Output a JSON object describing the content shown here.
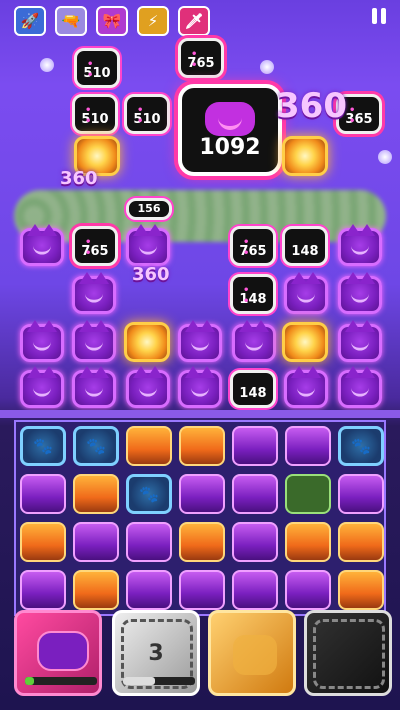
{
  "top_bar": {
    "powers": [
      {
        "name": "rocket-power",
        "color": "#3b6bd6",
        "glyph": "🚀"
      },
      {
        "name": "gun-power",
        "color": "#9a8ae0",
        "glyph": "🔫"
      },
      {
        "name": "bow-power",
        "color": "#b03ad0",
        "glyph": "🎀"
      },
      {
        "name": "battery-power",
        "color": "#e0a020",
        "glyph": "⚡"
      },
      {
        "name": "sword-power",
        "color": "#e0307a",
        "glyph": "🗡"
      }
    ],
    "pause_icon": "pause-icon"
  },
  "board": {
    "blocks": [
      {
        "value": "510"
      },
      {
        "value": "765"
      },
      {
        "value": "510"
      },
      {
        "value": "510"
      },
      {
        "value": "365"
      },
      {
        "value": "156"
      },
      {
        "value": "765"
      },
      {
        "value": "765"
      },
      {
        "value": "148"
      },
      {
        "value": "148"
      },
      {
        "value": "148"
      }
    ],
    "big_block": {
      "value": "1092"
    },
    "combos": [
      "360",
      "360",
      "360"
    ]
  },
  "power_cards": [
    {
      "name": "unicorn-cat-card",
      "progress": 0.12,
      "bg": "#e0307a"
    },
    {
      "name": "chained-card",
      "count": "3",
      "progress": 0.45,
      "bg": "#bbbbbb"
    },
    {
      "name": "golden-card",
      "bg": "#e09a20"
    },
    {
      "name": "locked-card",
      "bg": "#222222"
    }
  ]
}
